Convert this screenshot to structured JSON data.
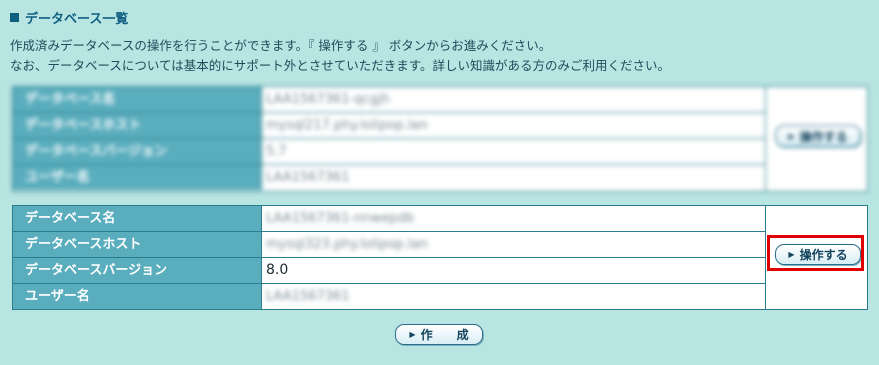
{
  "heading": "データベース一覧",
  "description": [
    "作成済みデータベースの操作を行うことができます。『 操作する 』 ボタンからお進みください。",
    "なお、データベースについては基本的にサポート外とさせていただきます。詳しい知識がある方のみご利用ください。"
  ],
  "databases": [
    {
      "fields": [
        {
          "label": "データベース名",
          "value": "LAA1567361-qcgjh"
        },
        {
          "label": "データベースホスト",
          "value": "mysql217.phy.lolipop.lan"
        },
        {
          "label": "データベースバージョン",
          "value": "5.7"
        },
        {
          "label": "ユーザー名",
          "value": "LAA1567361"
        }
      ],
      "action_label": "操作する"
    },
    {
      "fields": [
        {
          "label": "データベース名",
          "value": "LAA1567361-nnwepdb"
        },
        {
          "label": "データベースホスト",
          "value": "mysql323.phy.lolipop.lan"
        },
        {
          "label": "データベースバージョン",
          "value": "8.0"
        },
        {
          "label": "ユーザー名",
          "value": "LAA1567361"
        }
      ],
      "action_label": "操作する"
    }
  ],
  "create_button": "作　　成",
  "colors": {
    "background": "#b8e4e1",
    "label_bg": "#5aadbd",
    "highlight": "#e00000"
  }
}
